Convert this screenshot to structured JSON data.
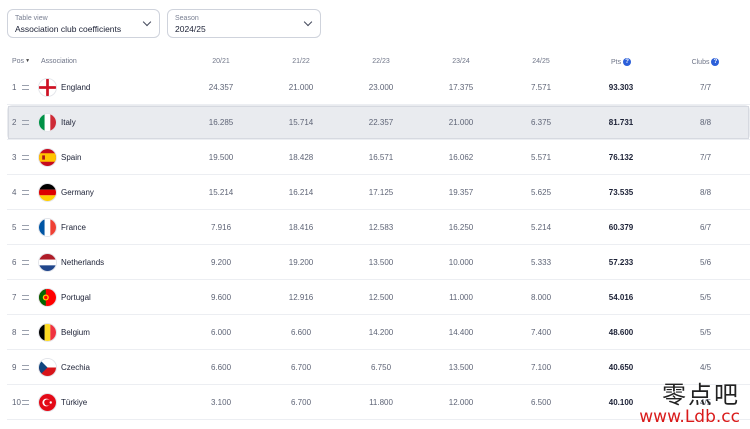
{
  "filters": {
    "table_view": {
      "label": "Table view",
      "value": "Association club coefficients"
    },
    "season": {
      "label": "Season",
      "value": "2024/25"
    }
  },
  "columns": {
    "pos": "Pos",
    "association": "Association",
    "y1": "20/21",
    "y2": "21/22",
    "y3": "22/23",
    "y4": "23/24",
    "y5": "24/25",
    "pts": "Pts",
    "clubs": "Clubs"
  },
  "rows": [
    {
      "pos": "1",
      "name": "England",
      "flag": "england-flag",
      "y1": "24.357",
      "y2": "21.000",
      "y3": "23.000",
      "y4": "17.375",
      "y5": "7.571",
      "pts": "93.303",
      "clubs": "7/7"
    },
    {
      "pos": "2",
      "name": "Italy",
      "flag": "italy-flag",
      "y1": "16.285",
      "y2": "15.714",
      "y3": "22.357",
      "y4": "21.000",
      "y5": "6.375",
      "pts": "81.731",
      "clubs": "8/8"
    },
    {
      "pos": "3",
      "name": "Spain",
      "flag": "spain-flag",
      "y1": "19.500",
      "y2": "18.428",
      "y3": "16.571",
      "y4": "16.062",
      "y5": "5.571",
      "pts": "76.132",
      "clubs": "7/7"
    },
    {
      "pos": "4",
      "name": "Germany",
      "flag": "germany-flag",
      "y1": "15.214",
      "y2": "16.214",
      "y3": "17.125",
      "y4": "19.357",
      "y5": "5.625",
      "pts": "73.535",
      "clubs": "8/8"
    },
    {
      "pos": "5",
      "name": "France",
      "flag": "france-flag",
      "y1": "7.916",
      "y2": "18.416",
      "y3": "12.583",
      "y4": "16.250",
      "y5": "5.214",
      "pts": "60.379",
      "clubs": "6/7"
    },
    {
      "pos": "6",
      "name": "Netherlands",
      "flag": "netherlands-flag",
      "y1": "9.200",
      "y2": "19.200",
      "y3": "13.500",
      "y4": "10.000",
      "y5": "5.333",
      "pts": "57.233",
      "clubs": "5/6"
    },
    {
      "pos": "7",
      "name": "Portugal",
      "flag": "portugal-flag",
      "y1": "9.600",
      "y2": "12.916",
      "y3": "12.500",
      "y4": "11.000",
      "y5": "8.000",
      "pts": "54.016",
      "clubs": "5/5"
    },
    {
      "pos": "8",
      "name": "Belgium",
      "flag": "belgium-flag",
      "y1": "6.000",
      "y2": "6.600",
      "y3": "14.200",
      "y4": "14.400",
      "y5": "7.400",
      "pts": "48.600",
      "clubs": "5/5"
    },
    {
      "pos": "9",
      "name": "Czechia",
      "flag": "czechia-flag",
      "y1": "6.600",
      "y2": "6.700",
      "y3": "6.750",
      "y4": "13.500",
      "y5": "7.100",
      "pts": "40.650",
      "clubs": "4/5"
    },
    {
      "pos": "10",
      "name": "Türkiye",
      "flag": "turkiye-flag",
      "y1": "3.100",
      "y2": "6.700",
      "y3": "11.800",
      "y4": "12.000",
      "y5": "6.500",
      "pts": "40.100",
      "clubs": "4/5"
    }
  ],
  "highlighted_row": "2",
  "watermark": {
    "chinese": "零点吧",
    "url": "www.Ldb.cc"
  },
  "colors": {
    "accent": "#2b5fd9",
    "highlight_row": "#e9ebef",
    "watermark_url": "#d91a1a"
  }
}
